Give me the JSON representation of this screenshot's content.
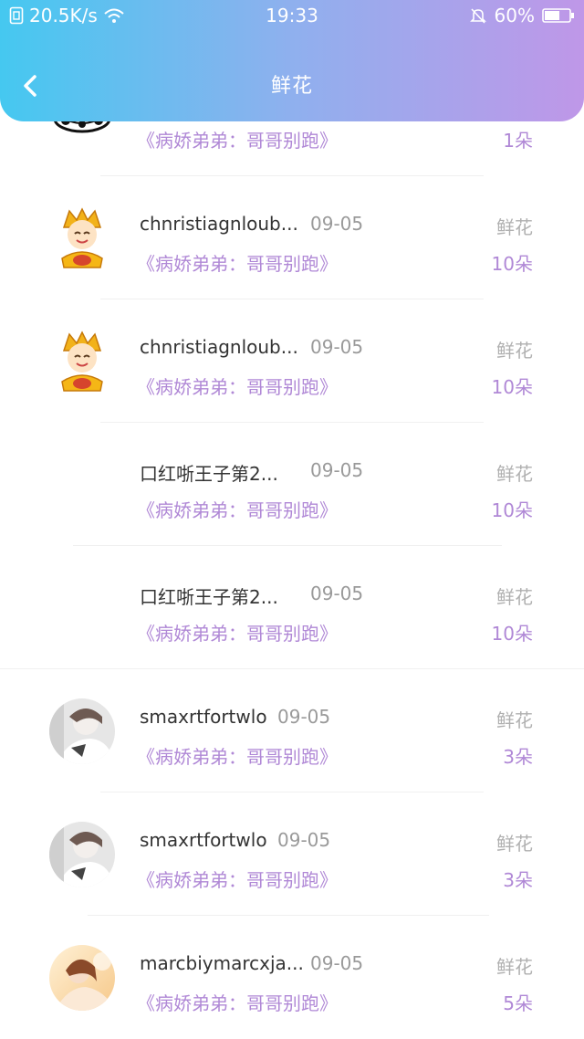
{
  "status_bar": {
    "speed": "20.5K/s",
    "time": "19:33",
    "battery": "60%"
  },
  "header": {
    "title": "鲜花"
  },
  "rows": [
    {
      "name": "",
      "date": "",
      "book": "《病娇弟弟：哥哥别跑》",
      "gift": "",
      "count": "1朵",
      "avatar": "cloud-avatar"
    },
    {
      "name": "chnristiagnloub...",
      "date": "09-05",
      "book": "《病娇弟弟：哥哥别跑》",
      "gift": "鲜花",
      "count": "10朵",
      "avatar": "monk-avatar"
    },
    {
      "name": "chnristiagnloub...",
      "date": "09-05",
      "book": "《病娇弟弟：哥哥别跑》",
      "gift": "鲜花",
      "count": "10朵",
      "avatar": "monk-avatar"
    },
    {
      "name": "口红哳王子第2...",
      "date": "09-05",
      "book": "《病娇弟弟：哥哥别跑》",
      "gift": "鲜花",
      "count": "10朵",
      "avatar": ""
    },
    {
      "name": "口红哳王子第2...",
      "date": "09-05",
      "book": "《病娇弟弟：哥哥别跑》",
      "gift": "鲜花",
      "count": "10朵",
      "avatar": ""
    },
    {
      "name": "smaxrtfortwlo",
      "date": "09-05",
      "book": "《病娇弟弟：哥哥别跑》",
      "gift": "鲜花",
      "count": "3朵",
      "avatar": "photo-avatar-gray"
    },
    {
      "name": "smaxrtfortwlo",
      "date": "09-05",
      "book": "《病娇弟弟：哥哥别跑》",
      "gift": "鲜花",
      "count": "3朵",
      "avatar": "photo-avatar-gray"
    },
    {
      "name": "marcbiymarcxja...",
      "date": "09-05",
      "book": "《病娇弟弟：哥哥别跑》",
      "gift": "鲜花",
      "count": "5朵",
      "avatar": "photo-avatar-warm"
    }
  ]
}
